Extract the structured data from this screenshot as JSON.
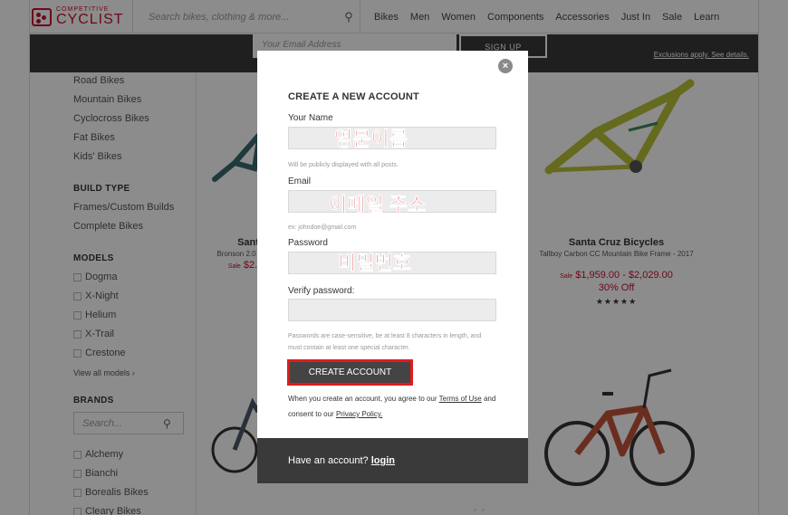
{
  "header": {
    "logo_small": "COMPETITIVE",
    "logo_big": "CYCLIST",
    "search_placeholder": "Search bikes, clothing & more...",
    "nav": [
      "Bikes",
      "Men",
      "Women",
      "Components",
      "Accessories",
      "Just In",
      "Sale",
      "Learn"
    ]
  },
  "band": {
    "email_placeholder": "Your Email Address",
    "signup": "SIGN UP",
    "exclusions": "Exclusions apply. See details."
  },
  "sidebar": {
    "categories": [
      "Road Bikes",
      "Mountain Bikes",
      "Cyclocross Bikes",
      "Fat Bikes",
      "Kids' Bikes"
    ],
    "build_type_head": "BUILD TYPE",
    "build_types": [
      "Frames/Custom Builds",
      "Complete Bikes"
    ],
    "models_head": "MODELS",
    "models": [
      "Dogma",
      "X-Night",
      "Helium",
      "X-Trail",
      "Crestone"
    ],
    "view_all": "View all models ›",
    "brands_head": "BRANDS",
    "brand_search_placeholder": "Search...",
    "brands": [
      "Alchemy",
      "Bianchi",
      "Borealis Bikes",
      "Cleary Bikes"
    ]
  },
  "products": {
    "left": {
      "name": "Sant",
      "sub": "Bronson 2.0",
      "price_prefix": "Sale",
      "price": "$2."
    },
    "right": {
      "name": "Santa Cruz Bicycles",
      "sub": "Tallboy Carbon CC Mountain Bike Frame - 2017",
      "price_prefix": "Sale",
      "price": "$1,959.00 - $2,029.00",
      "off": "30% Off",
      "stars": "★★★★★"
    }
  },
  "modal": {
    "title": "CREATE A NEW ACCOUNT",
    "name_label": "Your Name",
    "name_annot": "영문이름",
    "name_hint": "Will be publicly displayed with all posts.",
    "email_label": "Email",
    "email_annot": "이메일 주소",
    "email_hint": "ex: johndoe@gmail.com",
    "password_label": "Password",
    "password_annot": "비밀번호",
    "verify_label": "Verify password:",
    "password_hint": "Passwords are case-sensitive, be at least 8 characters in length, and must contain at least one special character.",
    "create_button": "CREATE ACCOUNT",
    "terms_pre": "When you create an account, you agree to our",
    "terms_link": "Terms of Use",
    "terms_mid": "and consent to our",
    "privacy_link": "Privacy Policy.",
    "footer_text": "Have an account?",
    "footer_login": "login"
  },
  "colors": {
    "brand_red": "#c8102e",
    "annotation_red": "#e21b1b",
    "dark_band": "#3a3a3a"
  }
}
